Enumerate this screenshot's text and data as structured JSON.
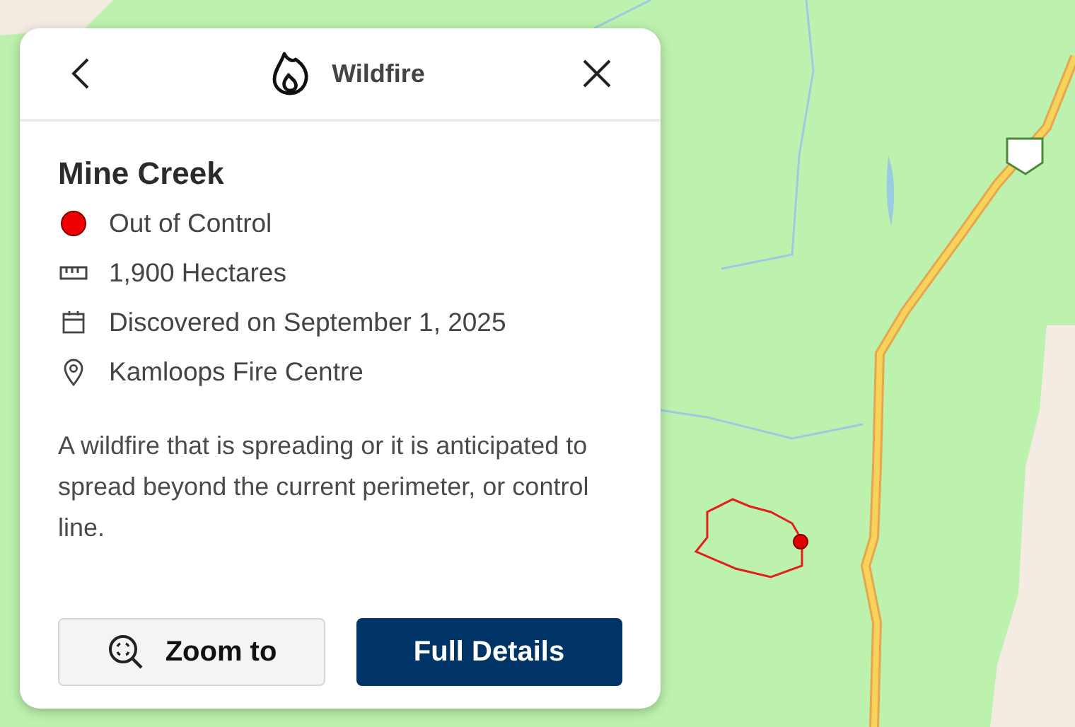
{
  "header": {
    "title": "Wildfire"
  },
  "fire": {
    "name": "Mine Creek",
    "details": [
      {
        "kind": "status",
        "text": "Out of Control",
        "color": "#ee0000"
      },
      {
        "kind": "size",
        "text": "1,900 Hectares"
      },
      {
        "kind": "date",
        "text": "Discovered on September 1, 2025"
      },
      {
        "kind": "location",
        "text": "Kamloops Fire Centre"
      }
    ],
    "description": "A wildfire that is spreading or it is anticipated to spread beyond the current perimeter, or control line."
  },
  "buttons": [
    {
      "kind": "secondary",
      "label": "Zoom to"
    },
    {
      "kind": "primary",
      "label": "Full Details"
    }
  ]
}
